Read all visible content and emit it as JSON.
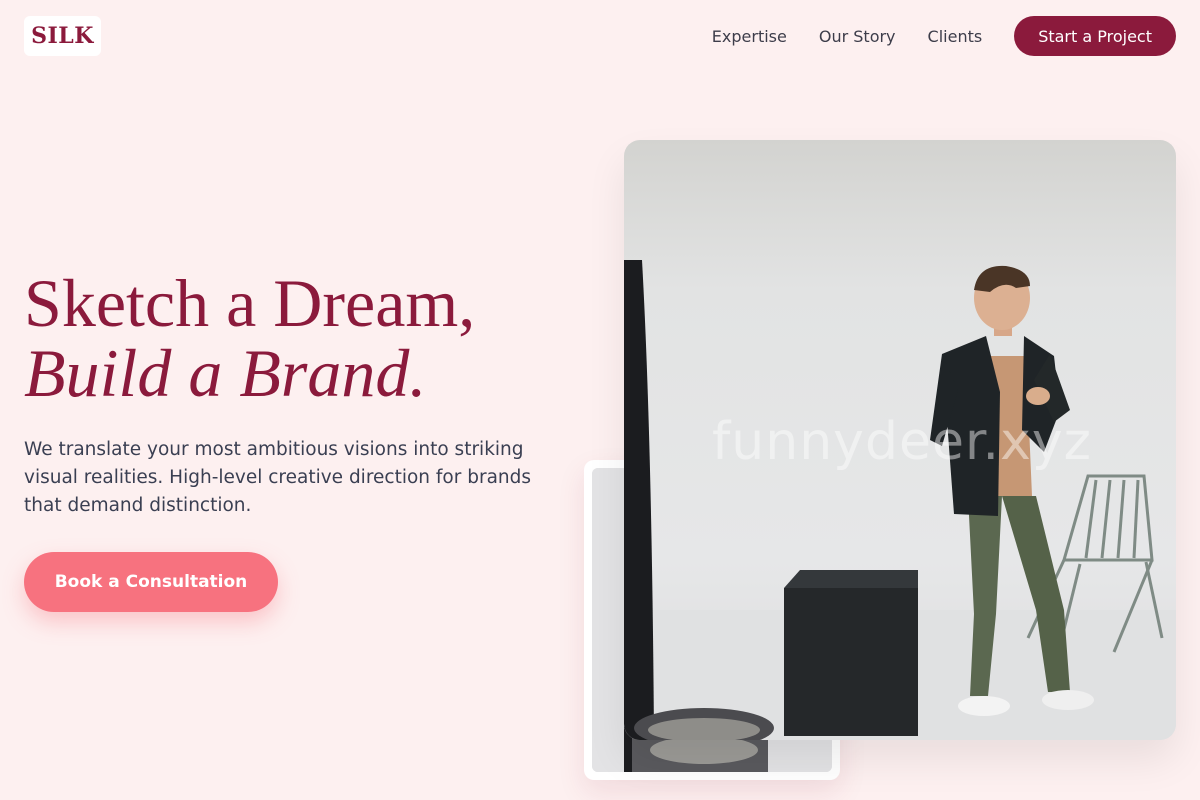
{
  "brand": {
    "logo_text": "SILK"
  },
  "nav": {
    "links": [
      "Expertise",
      "Our Story",
      "Clients"
    ],
    "cta_label": "Start a Project"
  },
  "hero": {
    "title_line1": "Sketch a Dream,",
    "title_line2": "Build a Brand.",
    "subtitle": "We translate your most ambitious visions into striking visual realities. High-level creative direction for brands that demand distinction.",
    "cta_label": "Book a Consultation"
  },
  "images": {
    "main_photo": "photo-man-in-blazer-studio",
    "secondary_photo": "photo-studio-detail",
    "watermark": "funnydeer.xyz"
  },
  "colors": {
    "background": "#fdf0f0",
    "brand": "#8b1a3c",
    "accent": "#f7727f",
    "body_text": "#3a3f52"
  }
}
